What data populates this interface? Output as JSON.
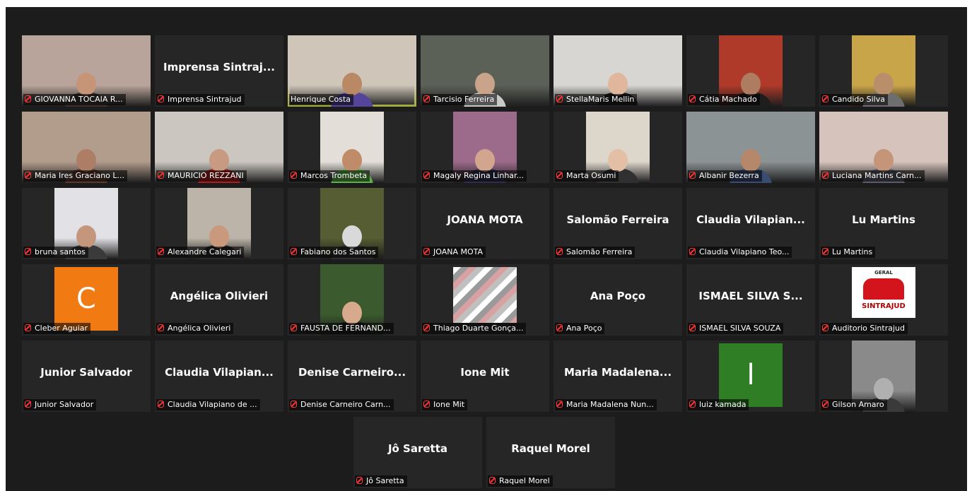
{
  "participants": [
    {
      "name": "GIOVANNA TOCAIA R...",
      "video": true,
      "bg": "#b8a49a",
      "skin": "#c69578",
      "shirt": "#3b3230",
      "muted": true
    },
    {
      "name": "Imprensa Sintrajud",
      "big": "Imprensa  Sintraj...",
      "video": false,
      "muted": true
    },
    {
      "name": "Henrique Costa",
      "video": true,
      "bg": "#cfc5b9",
      "skin": "#b98864",
      "shirt": "#55459a",
      "muted": false,
      "active": true
    },
    {
      "name": "Tarcisio Ferreira",
      "video": true,
      "bg": "#5b6157",
      "skin": "#caa48a",
      "shirt": "#c9c9c9",
      "muted": true
    },
    {
      "name": "StellaMaris Mellin",
      "video": true,
      "bg": "#d8d6d2",
      "skin": "#e0b79d",
      "shirt": "#1f1f1f",
      "muted": true
    },
    {
      "name": "Cátia Machado",
      "video": true,
      "narrow": true,
      "bg": "#b03a2a",
      "skin": "#ae7c61",
      "shirt": "#1e1e1e",
      "muted": true
    },
    {
      "name": "Candido Silva",
      "video": true,
      "narrow": true,
      "bg": "#c9a54a",
      "skin": "#b98f6b",
      "shirt": "#6e6e6e",
      "muted": true
    },
    {
      "name": "Maria Ires Graciano L...",
      "video": true,
      "bg": "#b29c8c",
      "skin": "#ad7e65",
      "shirt": "#5a3b2b",
      "muted": true
    },
    {
      "name": "MAURICIO REZZANI",
      "video": true,
      "bg": "#cbc7c0",
      "skin": "#c89a82",
      "shirt": "#aa2020",
      "muted": true
    },
    {
      "name": "Marcos Trombeta",
      "video": true,
      "narrow": true,
      "bg": "#e3dfd8",
      "skin": "#c08b68",
      "shirt": "#5fb04a",
      "muted": true
    },
    {
      "name": "Magaly Regina Linhar...",
      "video": true,
      "narrow": true,
      "bg": "#9c6a8a",
      "skin": "#d2a68e",
      "shirt": "#2e2e4a",
      "muted": true
    },
    {
      "name": "Marta Osumi",
      "video": true,
      "narrow": true,
      "bg": "#dcd6cb",
      "skin": "#e3bfa5",
      "shirt": "#303030",
      "muted": true
    },
    {
      "name": "Albanir Bezerra",
      "video": true,
      "bg": "#8c9394",
      "skin": "#b6876a",
      "shirt": "#3a4c70",
      "muted": true
    },
    {
      "name": "Luciana Martins Carn...",
      "video": true,
      "bg": "#d6c4bc",
      "skin": "#c59579",
      "shirt": "#5a5a6a",
      "muted": true
    },
    {
      "name": "bruna santos",
      "video": true,
      "narrow": true,
      "bg": "#e2e2e6",
      "skin": "#c4977d",
      "shirt": "#3a3a3a",
      "muted": true
    },
    {
      "name": "Alexandre Calegari",
      "video": true,
      "narrow": true,
      "bg": "#bcb4a8",
      "skin": "#c8997d",
      "shirt": "#2a2a2a",
      "muted": true
    },
    {
      "name": "Fabiano dos Santos",
      "video": true,
      "narrow": true,
      "bg": "#565d32",
      "skin": "#d9d9d9",
      "shirt": "#2f2f2f",
      "muted": true
    },
    {
      "name": "JOANA MOTA",
      "big": "JOANA MOTA",
      "video": false,
      "muted": true
    },
    {
      "name": "Salomão Ferreira",
      "big": "Salomão Ferreira",
      "video": false,
      "muted": true
    },
    {
      "name": "Claudia Vilapiano Teo...",
      "big": "Claudia  Vilapian...",
      "video": false,
      "muted": true
    },
    {
      "name": "Lu Martins",
      "big": "Lu Martins",
      "video": false,
      "muted": true
    },
    {
      "name": "Cleber Aguiar",
      "video": false,
      "avatar": "C",
      "avatar_bg": "#f27a12",
      "muted": true
    },
    {
      "name": "Angélica Olivieri",
      "big": "Angélica Olivieri",
      "video": false,
      "muted": true
    },
    {
      "name": "FAUSTA DE FERNAND...",
      "video": true,
      "narrow": true,
      "bg": "#3b5a2e",
      "skin": "#d7a98d",
      "shirt": "#1e1e1e",
      "muted": true
    },
    {
      "name": "Thiago Duarte Gonça...",
      "video": false,
      "image": "stripes",
      "muted": true
    },
    {
      "name": "Ana Poço",
      "big": "Ana Poço",
      "video": false,
      "muted": true
    },
    {
      "name": "ISMAEL SILVA SOUZA",
      "big": "ISMAEL  SILVA  S...",
      "video": false,
      "muted": true
    },
    {
      "name": "Auditorio Sintrajud",
      "video": false,
      "logo": true,
      "logo_top": "GERAL",
      "logo_mid": "SINTRAJUD",
      "muted": true
    },
    {
      "name": "Junior Salvador",
      "big": "Junior Salvador",
      "video": false,
      "muted": true
    },
    {
      "name": "Claudia Vilapiano de ...",
      "big": "Claudia  Vilapian...",
      "video": false,
      "muted": true
    },
    {
      "name": "Denise Carneiro Carn...",
      "big": "Denise  Carneiro...",
      "video": false,
      "muted": true
    },
    {
      "name": "Ione Mit",
      "big": "Ione Mit",
      "video": false,
      "muted": true
    },
    {
      "name": "Maria Madalena Nun...",
      "big": "Maria  Madalena...",
      "video": false,
      "muted": true
    },
    {
      "name": "luiz kamada",
      "video": false,
      "avatar": "l",
      "avatar_bg": "#2f7d24",
      "muted": true
    },
    {
      "name": "Gilson Amaro",
      "video": true,
      "narrow": true,
      "bg": "#8a8a8a",
      "skin": "#b0b0b0",
      "shirt": "#3a3a3a",
      "muted": true
    },
    {
      "name": "Jô Saretta",
      "big": "Jô Saretta",
      "video": false,
      "muted": true
    },
    {
      "name": "Raquel Morel",
      "big": "Raquel Morel",
      "video": false,
      "muted": true
    }
  ],
  "colors": {
    "background": "#1c1c1c",
    "tile": "#262626",
    "active_border": "#d9e44c",
    "muted_icon": "#ff3b3b"
  }
}
